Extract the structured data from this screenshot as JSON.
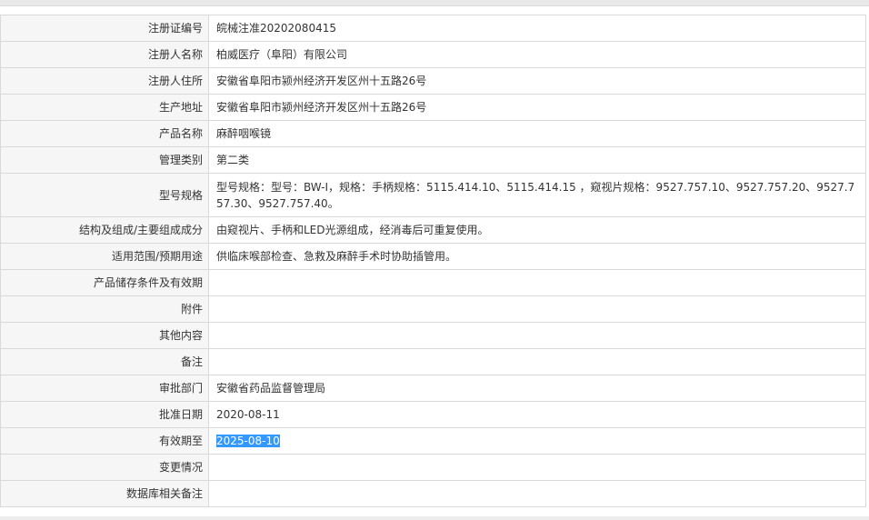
{
  "rows": [
    {
      "label": "注册证编号",
      "value": "皖械注准20202080415"
    },
    {
      "label": "注册人名称",
      "value": "柏威医疗（阜阳）有限公司"
    },
    {
      "label": "注册人住所",
      "value": "安徽省阜阳市颍州经济开发区州十五路26号"
    },
    {
      "label": "生产地址",
      "value": "安徽省阜阳市颍州经济开发区州十五路26号"
    },
    {
      "label": "产品名称",
      "value": "麻醉咽喉镜"
    },
    {
      "label": "管理类别",
      "value": "第二类"
    },
    {
      "label": "型号规格",
      "value": "型号规格：型号：BW-Ⅰ，规格：手柄规格：5115.414.10、5115.414.15 ，窥视片规格：9527.757.10、9527.757.20、9527.757.30、9527.757.40。"
    },
    {
      "label": "结构及组成/主要组成成分",
      "value": "由窥视片、手柄和LED光源组成，经消毒后可重复使用。"
    },
    {
      "label": "适用范围/预期用途",
      "value": "供临床喉部检查、急救及麻醉手术时协助插管用。"
    },
    {
      "label": "产品储存条件及有效期",
      "value": ""
    },
    {
      "label": "附件",
      "value": ""
    },
    {
      "label": "其他内容",
      "value": ""
    },
    {
      "label": "备注",
      "value": ""
    },
    {
      "label": "审批部门",
      "value": "安徽省药品监督管理局"
    },
    {
      "label": "批准日期",
      "value": "2020-08-11"
    },
    {
      "label": "有效期至",
      "value": "2025-08-10"
    },
    {
      "label": "变更情况",
      "value": ""
    },
    {
      "label": "数据库相关备注",
      "value": ""
    }
  ]
}
